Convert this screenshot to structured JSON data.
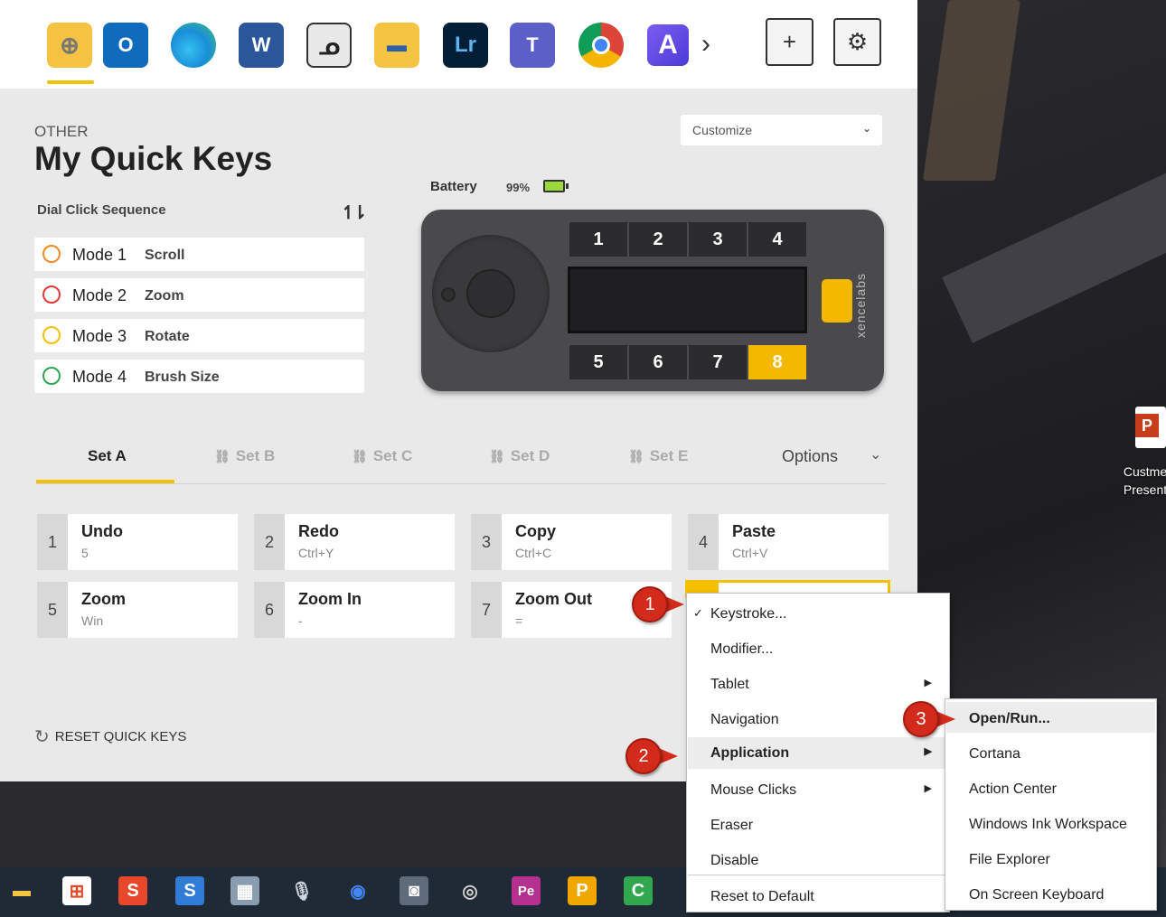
{
  "toolbar": {
    "apps": [
      {
        "name": "globe",
        "label": "⊕"
      },
      {
        "name": "outlook",
        "label": "O"
      },
      {
        "name": "edge",
        "label": ""
      },
      {
        "name": "word",
        "label": "W"
      },
      {
        "name": "clip-studio",
        "label": "ᓄ"
      },
      {
        "name": "file-explorer",
        "label": "▬"
      },
      {
        "name": "lightroom",
        "label": "Lr"
      },
      {
        "name": "teams",
        "label": "T"
      },
      {
        "name": "chrome",
        "label": ""
      },
      {
        "name": "app-a",
        "label": "A"
      }
    ],
    "more_glyph": "›",
    "add_glyph": "+",
    "settings_glyph": "⚙"
  },
  "header": {
    "category": "OTHER",
    "title": "My Quick Keys",
    "customize_value": "Customize",
    "customize_arrow": "⌄"
  },
  "dial": {
    "label": "Dial Click Sequence",
    "sort_glyph": "↿⇂",
    "modes": [
      {
        "label": "Mode 1",
        "value": "Scroll",
        "color": "#f08a24"
      },
      {
        "label": "Mode 2",
        "value": "Zoom",
        "color": "#e53935"
      },
      {
        "label": "Mode 3",
        "value": "Rotate",
        "color": "#f5c000"
      },
      {
        "label": "Mode 4",
        "value": "Brush Size",
        "color": "#2fa84f"
      }
    ]
  },
  "device": {
    "battery_label": "Battery",
    "battery_pct": "99%",
    "keys": [
      "1",
      "2",
      "3",
      "4",
      "5",
      "6",
      "7",
      "8"
    ],
    "active_key": "8",
    "brand": "xencelabs"
  },
  "sets": {
    "tabs": [
      {
        "label": "Set A",
        "link": ""
      },
      {
        "label": "Set B",
        "link": "⛓"
      },
      {
        "label": "Set C",
        "link": "⛓"
      },
      {
        "label": "Set D",
        "link": "⛓"
      },
      {
        "label": "Set E",
        "link": "⛓"
      }
    ],
    "options_label": "Options",
    "options_chevron": "⌄"
  },
  "quick_keys": [
    {
      "num": "1",
      "name": "Undo",
      "key": "5"
    },
    {
      "num": "2",
      "name": "Redo",
      "key": "Ctrl+Y"
    },
    {
      "num": "3",
      "name": "Copy",
      "key": "Ctrl+C"
    },
    {
      "num": "4",
      "name": "Paste",
      "key": "Ctrl+V"
    },
    {
      "num": "5",
      "name": "Zoom",
      "key": "Win"
    },
    {
      "num": "6",
      "name": "Zoom In",
      "key": "-"
    },
    {
      "num": "7",
      "name": "Zoom Out",
      "key": "="
    }
  ],
  "reset_label": "RESET QUICK KEYS",
  "context_menu": {
    "items": [
      "Keystroke...",
      "Modifier...",
      "Tablet",
      "Navigation",
      "Application",
      "Mouse Clicks",
      "Eraser",
      "Disable",
      "Reset to Default"
    ],
    "checked": "Keystroke...",
    "highlighted": "Application",
    "check_glyph": "✓",
    "submenu_glyph": "▶"
  },
  "submenu": {
    "items": [
      "Open/Run...",
      "Cortana",
      "Action Center",
      "Windows Ink Workspace",
      "File Explorer",
      "On Screen Keyboard"
    ],
    "highlighted": "Open/Run..."
  },
  "callouts": [
    "1",
    "2",
    "3"
  ],
  "desktop": {
    "shortcut_label_1": "Custme",
    "shortcut_label_2": "Present",
    "shortcut_badge": "P"
  },
  "taskbar": {
    "items": [
      {
        "name": "file-explorer",
        "label": "▬",
        "color": "#f6c443"
      },
      {
        "name": "store",
        "label": "⊞",
        "color": "#ffffff"
      },
      {
        "name": "app-s-red",
        "label": "S",
        "color": "#e8472b"
      },
      {
        "name": "app-s-blue",
        "label": "S",
        "color": "#2f7bd6"
      },
      {
        "name": "calculator",
        "label": "▦",
        "color": "#8a9cb0"
      },
      {
        "name": "microphone",
        "label": "🎙",
        "color": "#6b7684"
      },
      {
        "name": "chrome",
        "label": "◉",
        "color": "#4285f4"
      },
      {
        "name": "camera",
        "label": "◙",
        "color": "#5e6b7b"
      },
      {
        "name": "app-swirl",
        "label": "◎",
        "color": "#b9b9b9"
      },
      {
        "name": "app-pe",
        "label": "Pe",
        "color": "#b6318f"
      },
      {
        "name": "app-p",
        "label": "P",
        "color": "#f0a800"
      },
      {
        "name": "camtasia",
        "label": "C",
        "color": "#2fa84f"
      }
    ]
  }
}
